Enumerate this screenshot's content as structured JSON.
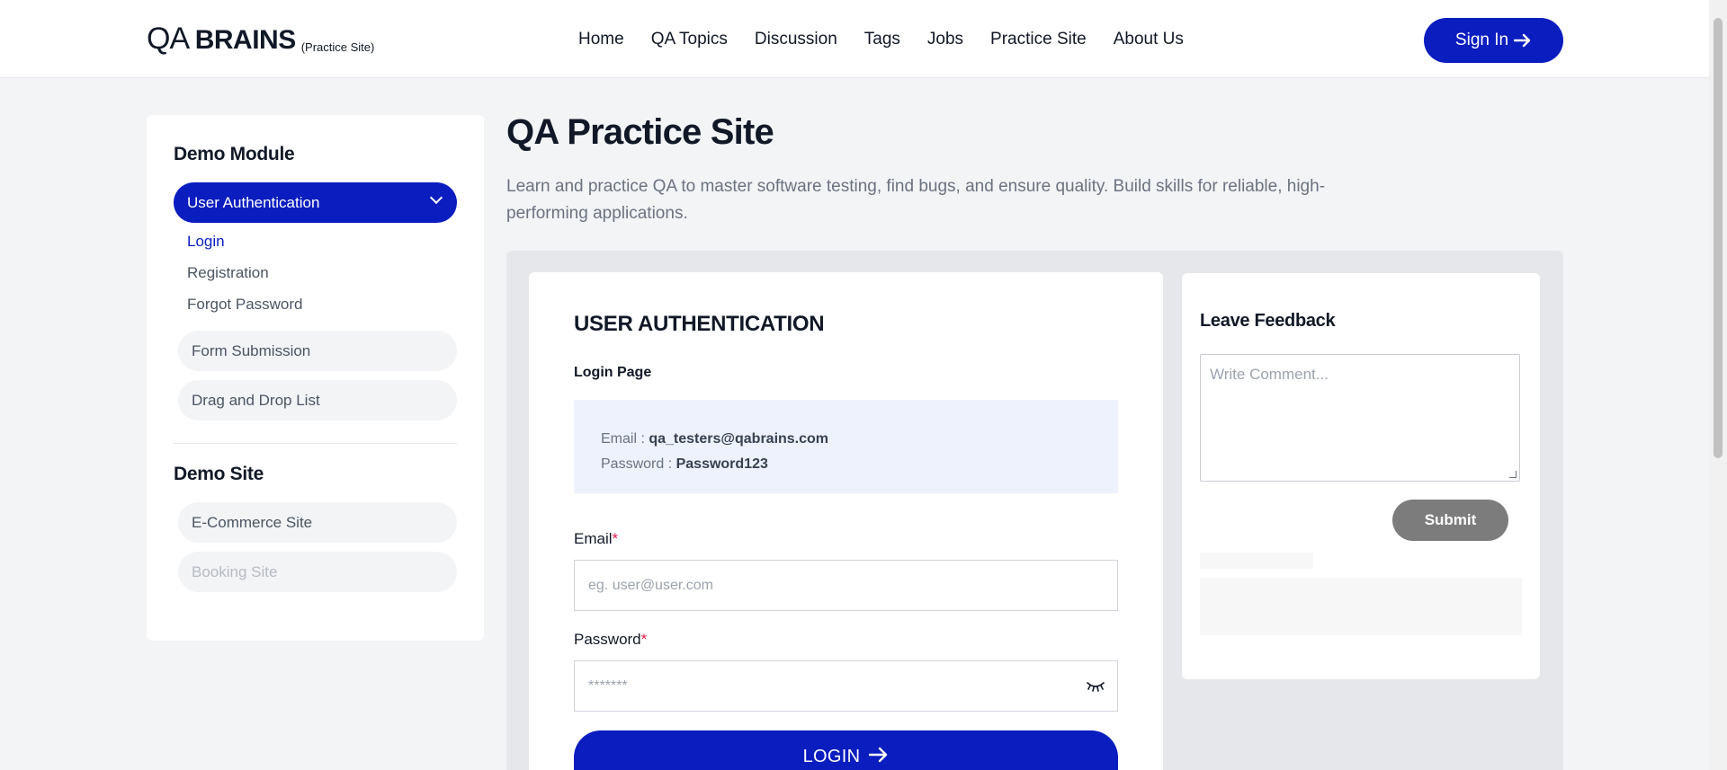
{
  "header": {
    "logo_main_a": "QA",
    "logo_main_b": "BRAINS",
    "logo_sub": "(Practice Site)",
    "nav": [
      "Home",
      "QA Topics",
      "Discussion",
      "Tags",
      "Jobs",
      "Practice Site",
      "About Us"
    ],
    "signin_label": "Sign In",
    "signin_icon": "arrow-right-icon"
  },
  "sidebar": {
    "module_heading": "Demo Module",
    "active_group": "User Authentication",
    "sub_items": [
      "Login",
      "Registration",
      "Forgot Password"
    ],
    "current_sub": "Login",
    "module_items": [
      "Form Submission",
      "Drag and Drop List"
    ],
    "site_heading": "Demo Site",
    "site_items": [
      "E-Commerce Site",
      "Booking Site"
    ],
    "disabled_item": "Booking Site"
  },
  "main": {
    "title": "QA Practice Site",
    "description": "Learn and practice QA to master software testing, find bugs, and ensure quality. Build skills for reliable, high-performing applications."
  },
  "auth_card": {
    "title": "USER AUTHENTICATION",
    "subtitle": "Login Page",
    "cred_email_label": "Email : ",
    "cred_email_value": "qa_testers@qabrains.com",
    "cred_password_label": "Password : ",
    "cred_password_value": "Password123",
    "email_label": "Email",
    "email_placeholder": "eg. user@user.com",
    "password_label": "Password",
    "password_placeholder": "*******",
    "required_mark": "*",
    "login_label": "LOGIN",
    "password_toggle_icon": "eye-closed-icon"
  },
  "feedback": {
    "title": "Leave Feedback",
    "placeholder": "Write Comment...",
    "submit_label": "Submit"
  },
  "colors": {
    "accent": "#0a1dbf",
    "background": "#f3f4f6",
    "disabled_button": "#7c7c7c",
    "required": "#e11d48"
  }
}
